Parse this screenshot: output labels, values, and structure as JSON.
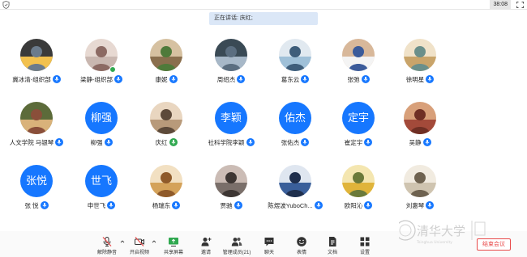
{
  "topbar": {
    "clock": "38:08",
    "shield_icon": "shield-icon",
    "fullscreen_icon": "fullscreen-icon"
  },
  "speaking": "正在讲话: 庆红;",
  "participants": [
    {
      "name": "冀冰清-组织部",
      "mic": "mic-on",
      "avatar": "photo"
    },
    {
      "name": "梁静-组织部",
      "mic": "mic-on",
      "avatar": "photo"
    },
    {
      "name": "康妮",
      "mic": "mic-on",
      "avatar": "photo"
    },
    {
      "name": "周绍杰",
      "mic": "mic-on",
      "avatar": "photo"
    },
    {
      "name": "葛东云",
      "mic": "mic-on",
      "avatar": "photo"
    },
    {
      "name": "张弛",
      "mic": "mic-on",
      "avatar": "photo"
    },
    {
      "name": "徐明星",
      "mic": "mic-on",
      "avatar": "photo"
    },
    {
      "name": "人文学院 马银琴",
      "mic": "mic-on",
      "avatar": "photo"
    },
    {
      "name": "柳强",
      "mic": "mic-on",
      "avatar_text": "柳强"
    },
    {
      "name": "庆红",
      "mic": "mic-on-green",
      "avatar": "photo"
    },
    {
      "name": "社科学院李颖",
      "mic": "mic-on",
      "avatar_text": "李颖"
    },
    {
      "name": "张佑杰",
      "mic": "mic-on",
      "avatar_text": "佑杰"
    },
    {
      "name": "崔定宇",
      "mic": "mic-on",
      "avatar_text": "定宇"
    },
    {
      "name": "吴静",
      "mic": "mic-on",
      "avatar": "photo"
    },
    {
      "name": "张 悦",
      "mic": "mic-on",
      "avatar_text": "张悦"
    },
    {
      "name": "申世飞",
      "mic": "mic-on",
      "avatar_text": "世飞"
    },
    {
      "name": "杨瑞东",
      "mic": "mic-on",
      "avatar": "photo"
    },
    {
      "name": "贾驰",
      "mic": "mic-on",
      "avatar": "photo"
    },
    {
      "name": "陈煜波YuboCh...",
      "mic": "mic-on",
      "avatar": "photo"
    },
    {
      "name": "欧阳沁",
      "mic": "mic-on",
      "avatar": "photo"
    },
    {
      "name": "刘惠琴",
      "mic": "mic-on",
      "avatar": "photo"
    }
  ],
  "toolbar": {
    "mute_all": "解除静音",
    "video": "开启视频",
    "share": "共享屏幕",
    "invite": "邀请",
    "members": "管理成员(21)",
    "chat": "聊天",
    "emoji": "表情",
    "docs": "文档",
    "settings": "设置",
    "end": "结束会议"
  },
  "logo_text": "清华大学",
  "colors": {
    "accent": "#1677ff",
    "end": "#e84a4a",
    "speaking_bg": "#dbe7f7"
  }
}
